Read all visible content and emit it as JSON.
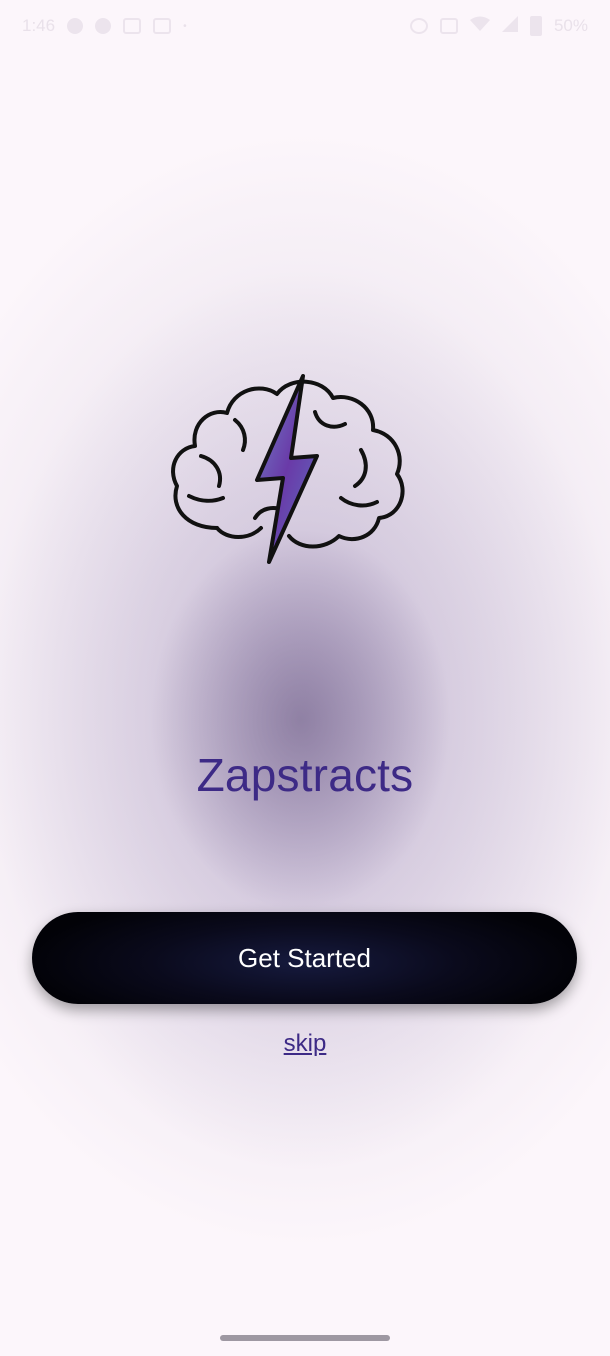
{
  "status_bar": {
    "time": "1:46",
    "battery": "50%"
  },
  "app": {
    "name": "Zapstracts",
    "logo_icon": "brain-lightning-icon"
  },
  "actions": {
    "get_started_label": "Get Started",
    "skip_label": "skip"
  },
  "colors": {
    "title": "#3d2a86",
    "button_bg": "#0a0a1c",
    "button_text": "#ffffff",
    "background": "#fcf6fb",
    "glow": "#9a88c4"
  }
}
